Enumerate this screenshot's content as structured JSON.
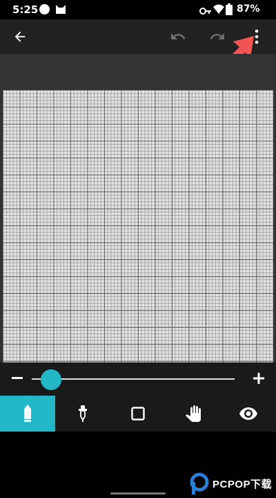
{
  "status_bar": {
    "time": "5:25",
    "battery_percent": "87%",
    "icons": [
      "notification-dot-icon",
      "cat-icon",
      "key-icon",
      "wifi-icon",
      "battery-icon"
    ]
  },
  "toolbar": {
    "icons": [
      "back-arrow-icon",
      "undo-icon",
      "redo-icon",
      "more-vert-icon"
    ],
    "undo_enabled": false,
    "redo_enabled": false
  },
  "annotation": {
    "arrow_color": "#f25454",
    "points_to": "more-vert-icon"
  },
  "canvas": {
    "grid": true,
    "background": "#e4e4e4"
  },
  "zoom": {
    "level": 0.05,
    "minus_icon": "minus-icon",
    "plus_icon": "plus-icon"
  },
  "tools": [
    {
      "name": "pencil",
      "icon": "pencil-icon",
      "active": true
    },
    {
      "name": "eyedropper",
      "icon": "eyedropper-icon",
      "active": false
    },
    {
      "name": "rectangle",
      "icon": "square-icon",
      "active": false
    },
    {
      "name": "pan",
      "icon": "hand-icon",
      "active": false
    },
    {
      "name": "preview",
      "icon": "eye-icon",
      "active": false
    }
  ],
  "colors": {
    "accent": "#22b8c8",
    "toolbar": "#222222",
    "workspace": "#333333"
  },
  "watermark": {
    "text": "PCPOP下载"
  }
}
